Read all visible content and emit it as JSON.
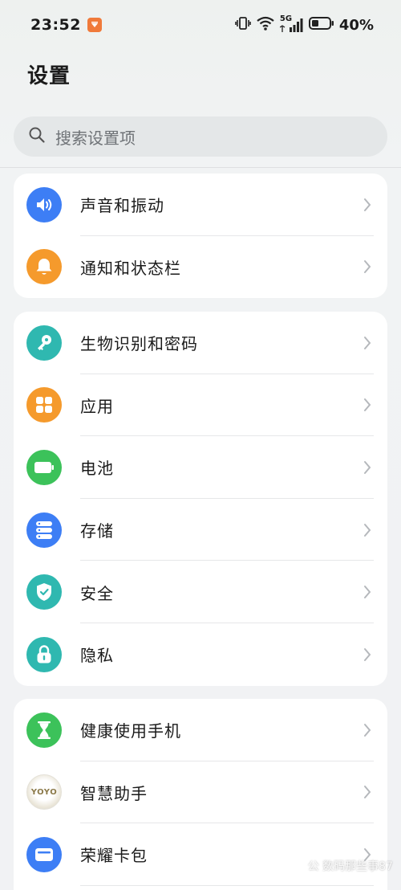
{
  "status_bar": {
    "time": "23:52",
    "network_label": "5G",
    "battery_percent": "40%",
    "battery_level": 0.4
  },
  "page": {
    "title": "设置",
    "search_placeholder": "搜索设置项"
  },
  "groups": [
    {
      "items": [
        {
          "label": "声音和振动",
          "icon": "speaker-icon",
          "color": "#3d7ef5"
        },
        {
          "label": "通知和状态栏",
          "icon": "bell-icon",
          "color": "#f59a2c"
        }
      ]
    },
    {
      "items": [
        {
          "label": "生物识别和密码",
          "icon": "key-icon",
          "color": "#2fb8b0"
        },
        {
          "label": "应用",
          "icon": "apps-grid-icon",
          "color": "#f59a2c"
        },
        {
          "label": "电池",
          "icon": "battery-icon",
          "color": "#3cc25a"
        },
        {
          "label": "存储",
          "icon": "storage-icon",
          "color": "#3d7ef5"
        },
        {
          "label": "安全",
          "icon": "shield-icon",
          "color": "#2fb8b0"
        },
        {
          "label": "隐私",
          "icon": "lock-icon",
          "color": "#2fb8b0"
        }
      ]
    },
    {
      "items": [
        {
          "label": "健康使用手机",
          "icon": "hourglass-icon",
          "color": "#3cc25a"
        },
        {
          "label": "智慧助手",
          "icon": "yoyo-assistant-icon",
          "icon_text": "YOYO",
          "color": "#f3f1ec"
        },
        {
          "label": "荣耀卡包",
          "icon": "wallet-icon",
          "color": "#3d7ef5"
        }
      ]
    }
  ],
  "watermark": "公 数码那些事87"
}
